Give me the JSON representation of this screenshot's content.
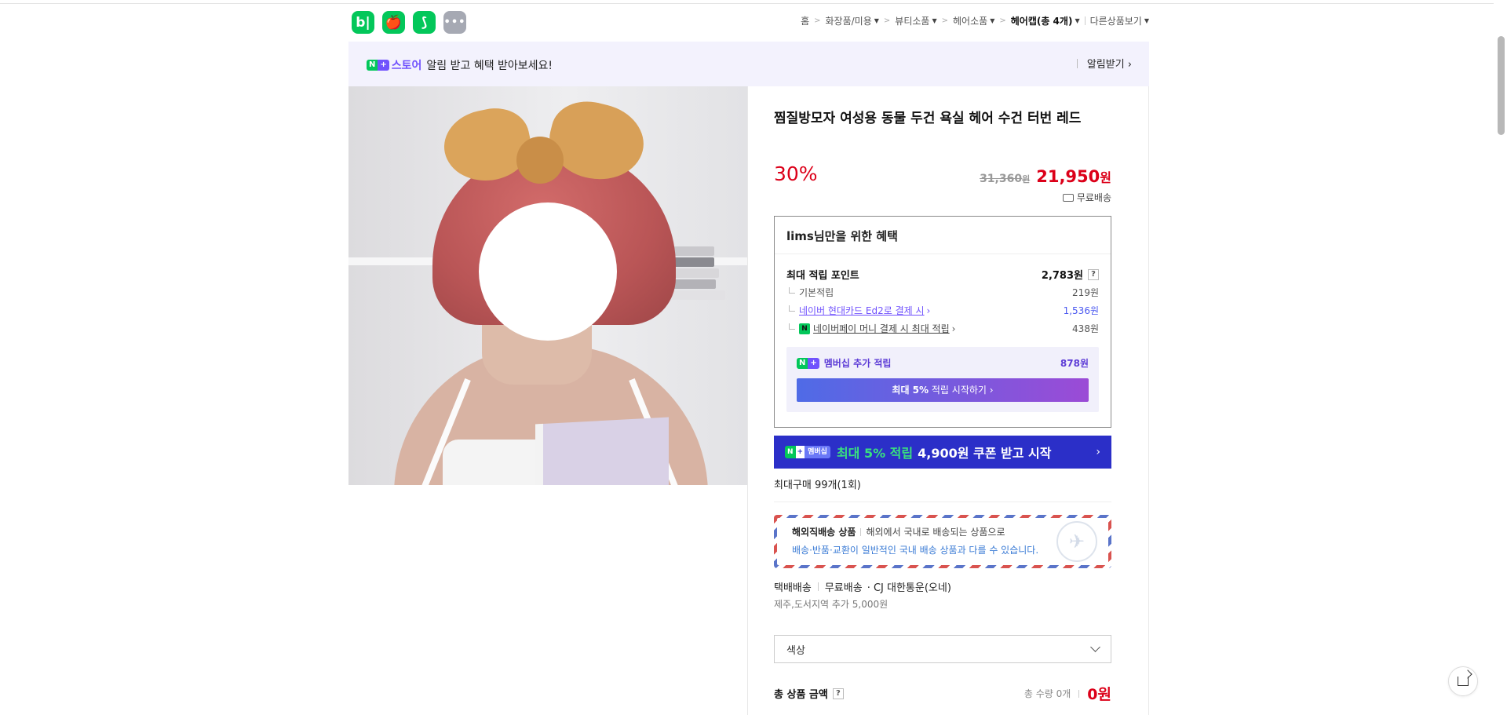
{
  "apps": [
    {
      "name": "blog-app",
      "glyph": "b|"
    },
    {
      "name": "shopping-app",
      "glyph": "🍎"
    },
    {
      "name": "bookmark-app",
      "glyph": "⟆"
    },
    {
      "name": "more-apps",
      "glyph": "•••"
    }
  ],
  "breadcrumb": {
    "home": "홈",
    "level1": "화장품/미용",
    "level2": "뷰티소품",
    "level3": "헤어소품",
    "current": "헤어캡(총 4개)",
    "other": "다른상품보기"
  },
  "banner": {
    "n_badge": "N",
    "plus_badge": "+",
    "store_label": "스토어",
    "message": "알림 받고 혜택 받아보세요!",
    "alarm_label": "알림받기 ›"
  },
  "product": {
    "title": "찜질방모자 여성용 동물 두건 욕실 헤어 수건 터번 레드",
    "discount": "30%",
    "original_price": "31,360",
    "original_unit": "원",
    "sale_price": "21,950",
    "sale_unit": "원",
    "shipping": "무료배송"
  },
  "benefit": {
    "title": "lims님만을 위한 혜택",
    "max_points_label": "최대 적립 포인트",
    "max_points_value": "2,783원",
    "help": "?",
    "rows": [
      {
        "label": "기본적립",
        "value": "219원"
      },
      {
        "label": "네이버 현대카드 Ed2로 결제 시",
        "value": "1,536원"
      },
      {
        "label": "네이버페이 머니 결제 시 최대 적립",
        "value": "438원"
      }
    ],
    "npay_icon": "N",
    "membership_label": "멤버십 추가 적립",
    "membership_value": "878원",
    "membership_btn_bold": "최대 5%",
    "membership_btn_rest": "적립 시작하기 ›"
  },
  "coupon": {
    "badge_n": "N",
    "badge_plus": "+",
    "badge_member": "멤버십",
    "green_text": "최대 5% 적립",
    "white_text": "4,900원 쿠폰 받고 시작",
    "arrow": "›"
  },
  "purchase": {
    "max_buy": "최대구매 99개(1회)"
  },
  "intl": {
    "title": "해외직배송 상품",
    "desc": "해외에서 국내로 배송되는 상품으로",
    "note": "배송·반품·교환이 일반적인 국내 배송 상품과 다를 수 있습니다.",
    "stamp": "✈"
  },
  "delivery": {
    "method": "택배배송",
    "fee": "무료배송",
    "carrier": "· CJ 대한통운(오네)",
    "extra": "제주,도서지역 추가 5,000원"
  },
  "option": {
    "placeholder": "색상"
  },
  "total": {
    "label": "총 상품 금액",
    "help": "?",
    "qty": "총 수량 0개",
    "amount": "0원"
  },
  "colors": {
    "naver_green": "#03c75a",
    "store_purple": "#7052fd",
    "price_red": "#dc0019",
    "coupon_blue": "#2b2fc8"
  }
}
